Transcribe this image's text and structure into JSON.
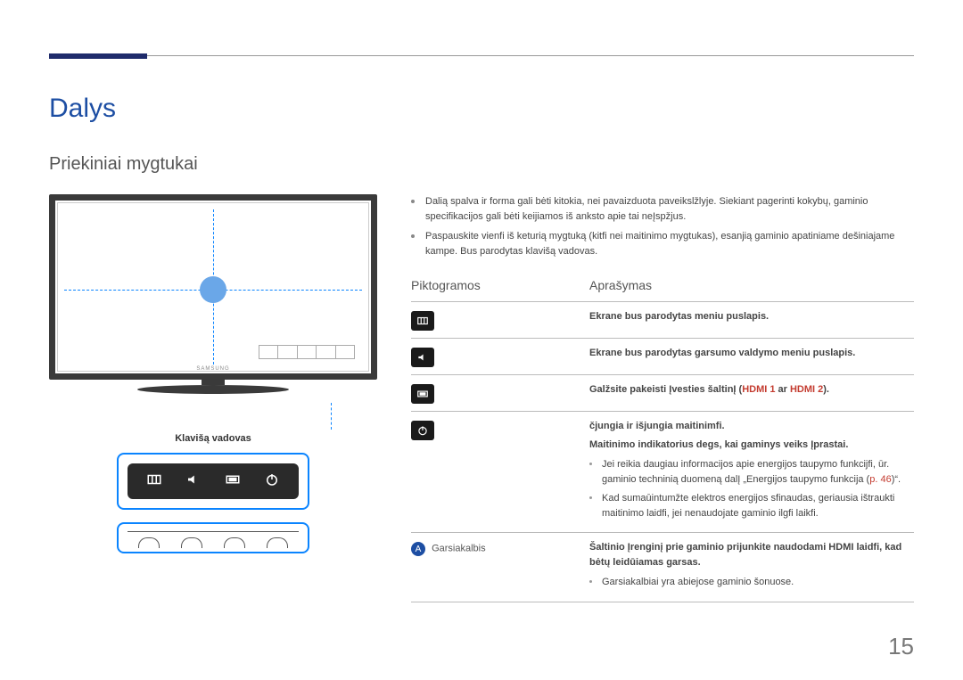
{
  "page_number": "15",
  "chapter_title": "Dalys",
  "section_title": "Priekiniai mygtukai",
  "guide_label": "Klavišą vadovas",
  "tv_brand": "SAMSUNG",
  "intro_notes": [
    "Dalią spalva ir forma gali bėti kitokia, nei pavaizduota paveikslžlyje. Siekiant pagerinti kokybų, gaminio specifikacijos gali bėti keijiamos iš anksto apie tai neĮspžjus.",
    "Paspauskite vienfi iš keturią mygtuką (kitfi nei maitinimo mygtukas), esanjią gaminio apatiniame dešiniajame kampe. Bus parodytas klavišą vadovas."
  ],
  "headers": {
    "pictograms": "Piktogramos",
    "description": "Aprašymas"
  },
  "rows": {
    "menu": {
      "desc": "Ekrane bus parodytas meniu puslapis."
    },
    "volume": {
      "desc": "Ekrane bus parodytas garsumo valdymo meniu puslapis."
    },
    "source": {
      "desc_prefix": "Galžsite pakeisti Įvesties šaltinĮ (",
      "hdmi1": "HDMI 1",
      "or": " ar ",
      "hdmi2": "HDMI 2",
      "desc_suffix": ")."
    },
    "power": {
      "desc1": "čjungia ir išjungia maitinimfi.",
      "desc2": "Maitinimo indikatorius degs, kai gaminys veiks Įprastai.",
      "sub1_a": "Jei reikia daugiau informacijos apie energijos taupymo funkcijfi, ūr. gaminio techninią duomeną dalĮ „Energijos taupymo funkcija (",
      "sub1_link": "p. 46",
      "sub1_b": ")“.",
      "sub2": "Kad sumaūintumžte elektros energijos sfinaudas, geriausia ištraukti maitinimo laidfi, jei nenaudojate gaminio ilgfi laikfi."
    },
    "speaker": {
      "label_letter": "A",
      "label": "Garsiakalbis",
      "desc": "Šaltinio Įrenginį prie gaminio prijunkite naudodami HDMI laidfi, kad bėtų leidūiamas garsas.",
      "sub": "Garsiakalbiai yra abiejose gaminio šonuose."
    }
  }
}
